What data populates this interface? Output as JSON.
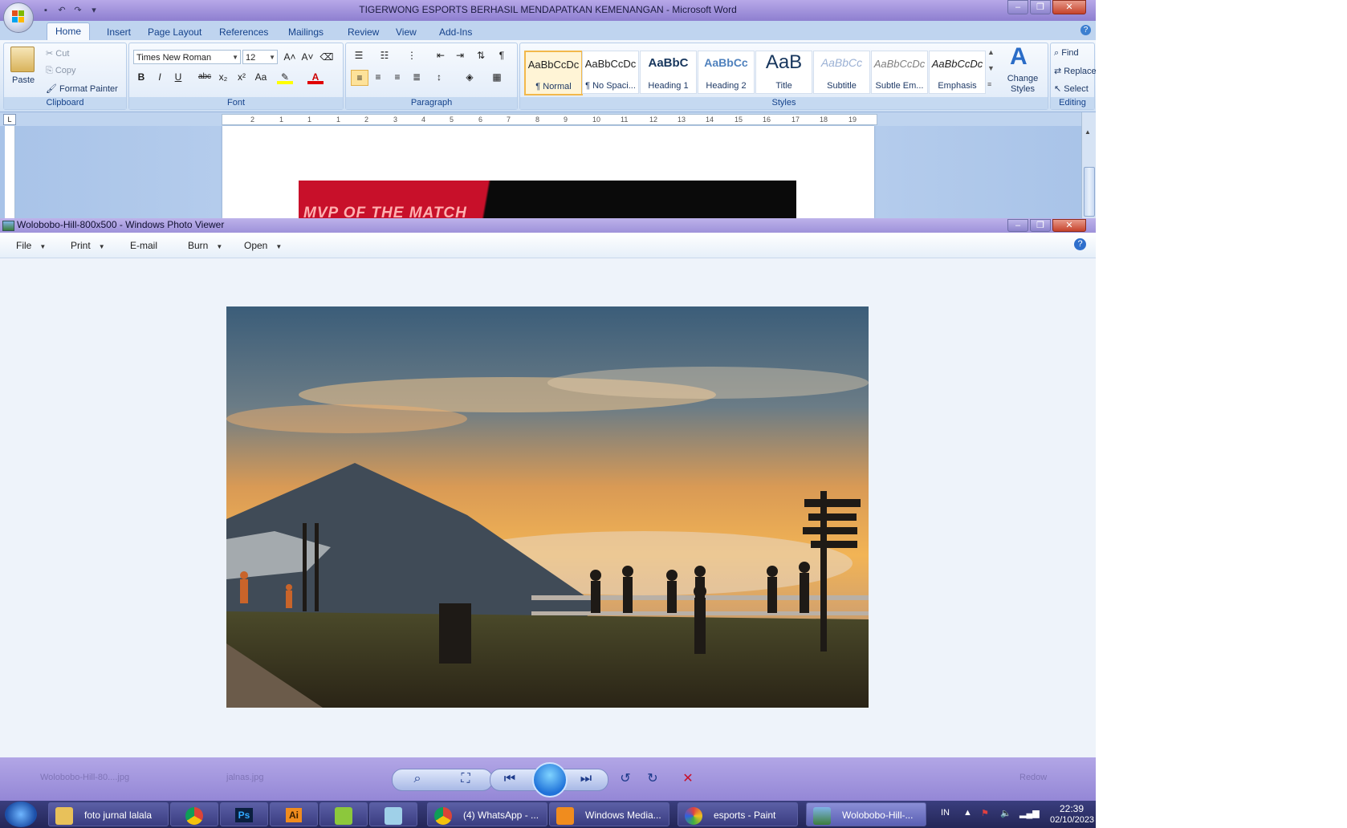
{
  "word": {
    "title": "TIGERWONG ESPORTS BERHASIL MENDAPATKAN KEMENANGAN - Microsoft Word",
    "tabs": [
      "Home",
      "Insert",
      "Page Layout",
      "References",
      "Mailings",
      "Review",
      "View",
      "Add-Ins"
    ],
    "clipboard": {
      "paste": "Paste",
      "cut": "Cut",
      "copy": "Copy",
      "format_painter": "Format Painter",
      "label": "Clipboard"
    },
    "font": {
      "name": "Times New Roman",
      "size": "12",
      "label": "Font",
      "bold": "B",
      "italic": "I",
      "underline": "U",
      "strike": "abc",
      "sub": "x₂",
      "sup": "x²",
      "case": "Aa",
      "grow": "A˄",
      "shrink": "A˅"
    },
    "paragraph": {
      "label": "Paragraph",
      "pilcrow": "¶"
    },
    "styles": {
      "label": "Styles",
      "items": [
        {
          "sample": "AaBbCcDc",
          "name": "¶ Normal"
        },
        {
          "sample": "AaBbCcDc",
          "name": "¶ No Spaci..."
        },
        {
          "sample": "AaBbC",
          "name": "Heading 1"
        },
        {
          "sample": "AaBbCc",
          "name": "Heading 2"
        },
        {
          "sample": "AaB",
          "name": "Title"
        },
        {
          "sample": "AaBbCc",
          "name": "Subtitle"
        },
        {
          "sample": "AaBbCcDc",
          "name": "Subtle Em..."
        },
        {
          "sample": "AaBbCcDc",
          "name": "Emphasis"
        }
      ],
      "change_styles": "Change Styles"
    },
    "editing": {
      "find": "Find",
      "replace": "Replace",
      "select": "Select",
      "label": "Editing"
    },
    "ruler": [
      "2",
      "1",
      "1",
      "1",
      "2",
      "3",
      "4",
      "5",
      "6",
      "7",
      "8",
      "9",
      "10",
      "11",
      "12",
      "13",
      "14",
      "15",
      "16",
      "17",
      "18",
      "19"
    ],
    "doc_image_text": "MVP OF THE MATCH"
  },
  "viewer": {
    "title": "Wolobobo-Hill-800x500 - Windows Photo Viewer",
    "menu": [
      "File",
      "Print",
      "E-mail",
      "Burn",
      "Open"
    ],
    "status_left": "Wolobobo-Hill-80....jpg",
    "status_mid": "jalnas.jpg",
    "status_right": "Redow"
  },
  "taskbar": {
    "items": [
      {
        "label": "foto jurnal lalala",
        "icon": "folder-icon"
      },
      {
        "label": "",
        "icon": "chrome-icon"
      },
      {
        "label": "Ps",
        "icon": "photoshop-icon"
      },
      {
        "label": "Ai",
        "icon": "illustrator-icon"
      },
      {
        "label": "",
        "icon": "app-icon"
      },
      {
        "label": "",
        "icon": "notepad-icon"
      },
      {
        "label": "(4) WhatsApp - ...",
        "icon": "chrome-icon"
      },
      {
        "label": "Windows Media...",
        "icon": "media-player-icon"
      },
      {
        "label": "esports - Paint",
        "icon": "paint-icon"
      },
      {
        "label": "Wolobobo-Hill-...",
        "icon": "photo-viewer-icon"
      }
    ],
    "lang": "IN",
    "time": "22:39",
    "date": "02/10/2023"
  },
  "colors": {
    "accent": "#15428b",
    "titlebar": "#9e92da",
    "taskbar": "#2a2d66"
  }
}
